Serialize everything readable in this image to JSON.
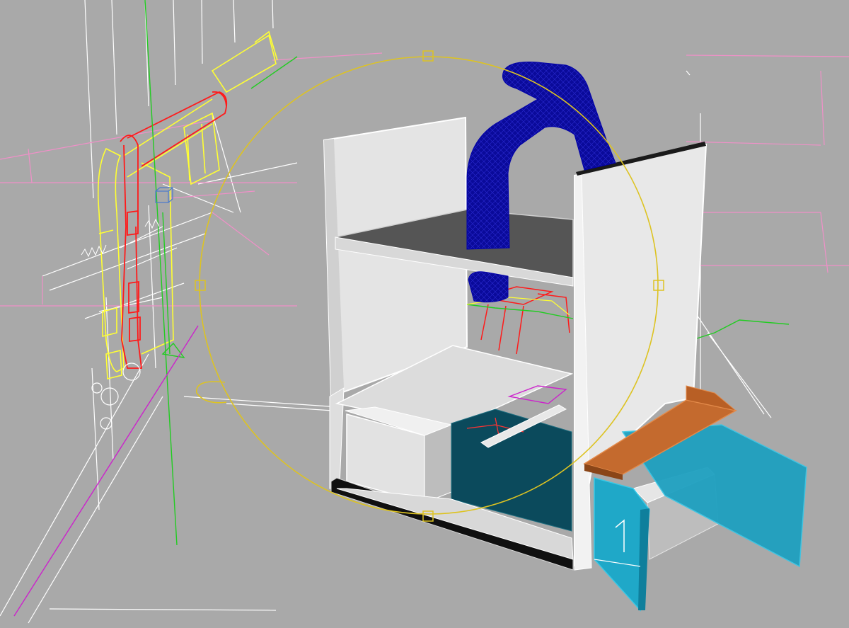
{
  "viewport": {
    "background": "#a9a9a9",
    "shading_mode": "wireframe-overlay"
  },
  "colors": {
    "wire_white": "#ffffff",
    "wire_red": "#ff1a1a",
    "wire_yellow": "#ffff33",
    "wire_pink": "#f090c8",
    "wire_green": "#22cc22",
    "wire_magenta": "#cc22cc",
    "gizmo": "#ddc322",
    "duct_blue": "#0a0a9a",
    "cabinet_white": "#e6e6e6",
    "shelf_dark": "#555555",
    "door_teal": "#1ea0c0",
    "interior_teal": "#0b4a5c",
    "tray_orange": "#c46a2e"
  },
  "objects": [
    {
      "name": "duct-pipe",
      "material": "blue-mesh"
    },
    {
      "name": "cabinet-frame",
      "material": "white"
    },
    {
      "name": "drawer-left",
      "material": "white"
    },
    {
      "name": "door-right",
      "material": "teal-glass"
    },
    {
      "name": "tray",
      "material": "orange"
    },
    {
      "name": "machine-wireframe",
      "material": "wireframe"
    }
  ],
  "gizmo": {
    "type": "rotate",
    "handles": [
      "top",
      "right",
      "bottom",
      "left"
    ]
  }
}
